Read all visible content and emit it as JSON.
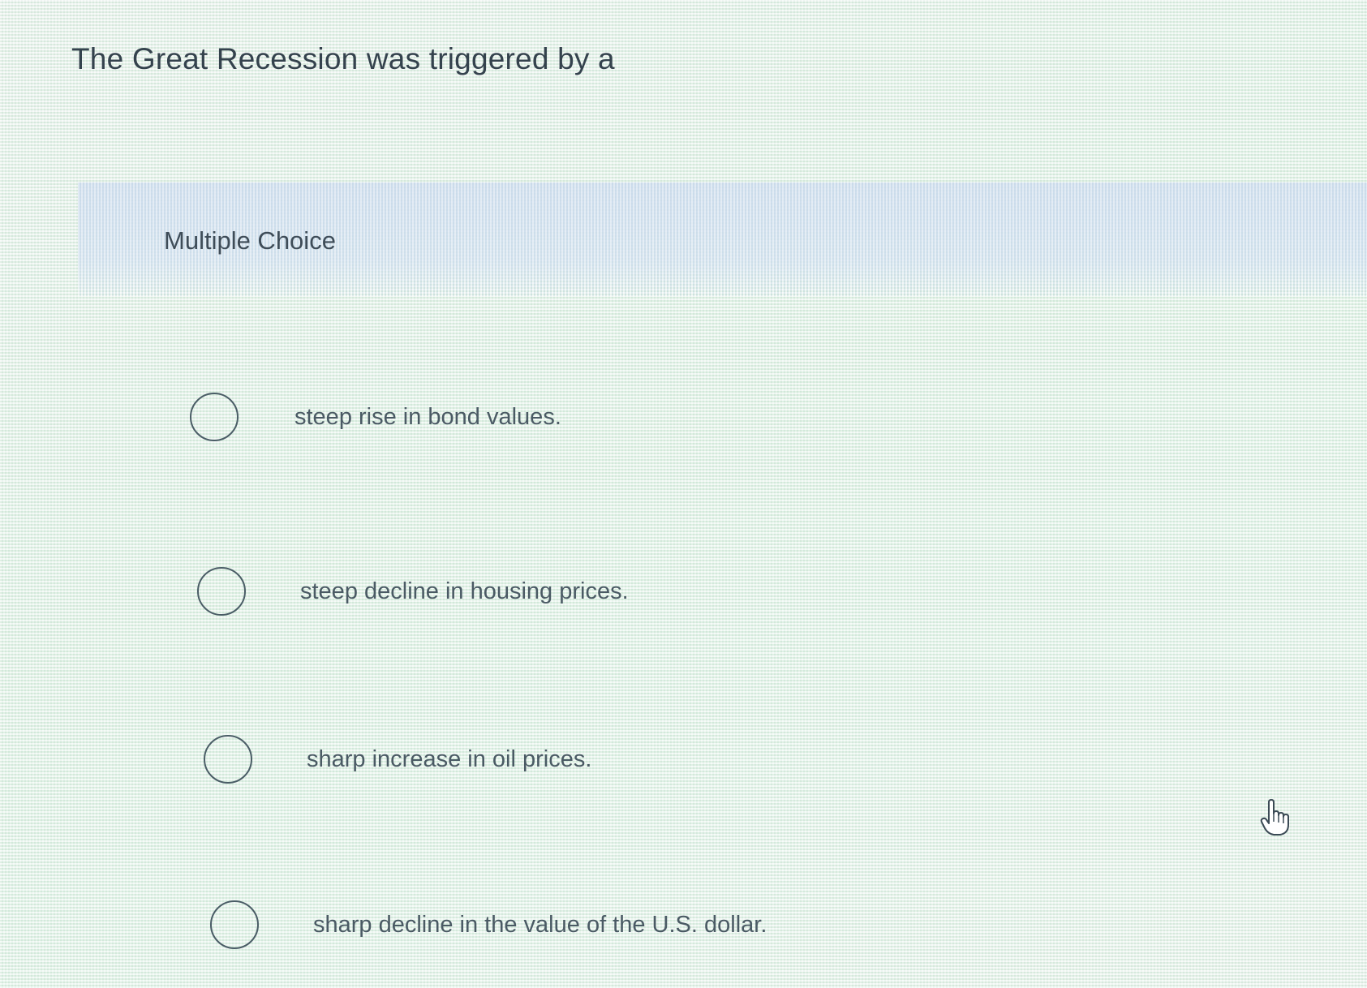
{
  "question": {
    "text": "The Great Recession was triggered by a"
  },
  "section": {
    "label": "Multiple Choice"
  },
  "options": [
    {
      "text": "steep rise in bond values."
    },
    {
      "text": "steep decline in housing prices."
    },
    {
      "text": "sharp increase in oil prices."
    },
    {
      "text": "sharp decline in the value of the U.S. dollar."
    }
  ],
  "cursor": {
    "icon": "hand-pointer-icon"
  },
  "colors": {
    "text": "#34424d",
    "band": "#cddcee",
    "radio_border": "#4a5d66"
  }
}
